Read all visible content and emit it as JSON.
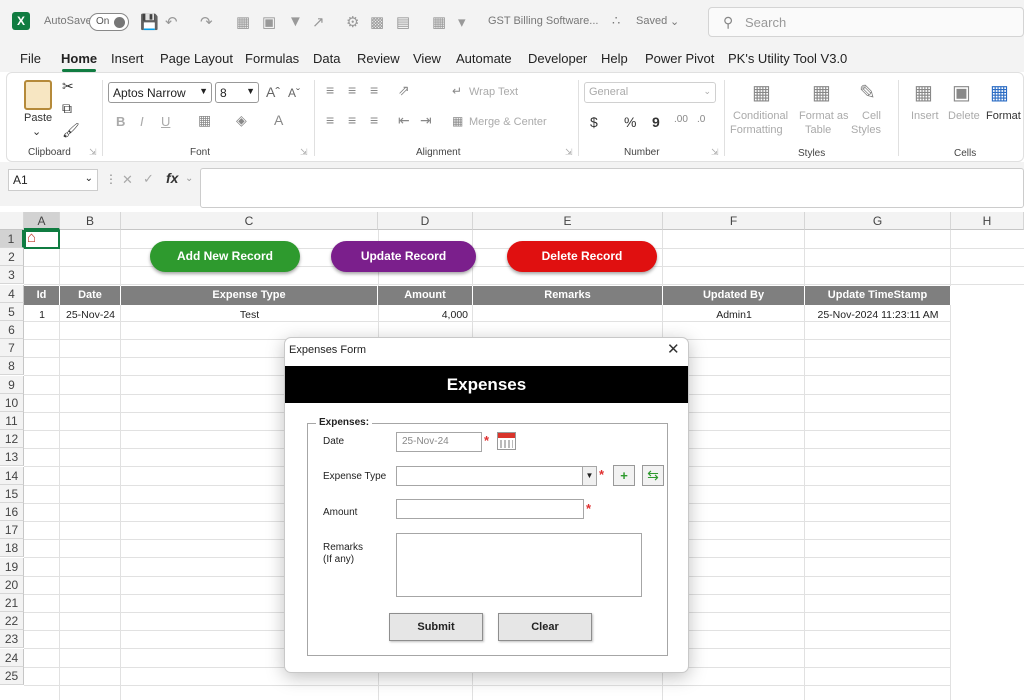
{
  "titlebar": {
    "autosave_label": "AutoSave",
    "autosave_state": "On",
    "file_name": "GST Billing Software...",
    "save_status": "Saved",
    "search_placeholder": "Search"
  },
  "menu": [
    "File",
    "Home",
    "Insert",
    "Page Layout",
    "Formulas",
    "Data",
    "Review",
    "View",
    "Automate",
    "Developer",
    "Help",
    "Power Pivot",
    "PK's Utility Tool V3.0"
  ],
  "ribbon": {
    "clipboard": {
      "paste": "Paste",
      "group": "Clipboard"
    },
    "font": {
      "name": "Aptos Narrow",
      "size": "8",
      "group": "Font",
      "bold": "B",
      "italic": "I",
      "underline": "U"
    },
    "alignment": {
      "wrap_text": "Wrap Text",
      "merge_center": "Merge & Center",
      "group": "Alignment"
    },
    "number": {
      "format": "General",
      "currency": "$",
      "percent": "%",
      "comma": "9",
      "group": "Number"
    },
    "styles": {
      "conditional_1": "Conditional",
      "conditional_2": "Formatting",
      "table_1": "Format as",
      "table_2": "Table",
      "cell_1": "Cell",
      "cell_2": "Styles",
      "group": "Styles"
    },
    "cells": {
      "insert": "Insert",
      "delete": "Delete",
      "format": "Format",
      "group": "Cells"
    }
  },
  "formula_bar": {
    "name_box": "A1",
    "fx": "fx"
  },
  "columns": [
    "A",
    "B",
    "C",
    "D",
    "E",
    "F",
    "G",
    "H"
  ],
  "rows": [
    "1",
    "2",
    "3",
    "4",
    "5",
    "6",
    "7",
    "8",
    "9",
    "10",
    "11",
    "12",
    "13",
    "14",
    "15",
    "16",
    "17",
    "18",
    "19",
    "20",
    "21",
    "22",
    "23",
    "24",
    "25"
  ],
  "actions": {
    "add": {
      "label": "Add New Record",
      "color": "#2e9a2e"
    },
    "update": {
      "label": "Update Record",
      "color": "#7b1f8c"
    },
    "delete": {
      "label": "Delete Record",
      "color": "#e01010"
    }
  },
  "table": {
    "headers": [
      "Id",
      "Date",
      "Expense Type",
      "Amount",
      "Remarks",
      "Updated By",
      "Update TimeStamp"
    ],
    "rows": [
      [
        "1",
        "25-Nov-24",
        "Test",
        "4,000",
        "",
        "Admin1",
        "25-Nov-2024 11:23:11 AM"
      ]
    ],
    "header_color": "#7f7f7f"
  },
  "form": {
    "window_title": "Expenses Form",
    "banner": "Expenses",
    "section": "Expenses:",
    "date_label": "Date",
    "date_value": "25-Nov-24",
    "type_label": "Expense Type",
    "amount_label": "Amount",
    "remarks_label_1": "Remarks",
    "remarks_label_2": "(If any)",
    "required_mark": "*",
    "add_type": "+",
    "submit": "Submit",
    "clear": "Clear"
  }
}
